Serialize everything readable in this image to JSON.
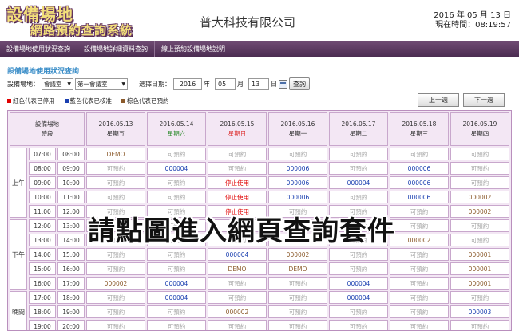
{
  "header": {
    "logo_line1": "設備場地",
    "logo_line2": "網路預約查詢系統",
    "company": "普大科技有限公司",
    "date": "2016 年 05 月 13 日",
    "now": "現在時間：08:19:57"
  },
  "nav": [
    "設備場地使用狀況查詢",
    "設備場地詳細資料查詢",
    "線上預約設備場地說明"
  ],
  "section_title": "設備場地使用狀況查詢",
  "filters": {
    "venue_label": "設備場地：",
    "venue_type": "會議室",
    "venue_name": "第一會議室",
    "date_label": "選擇日期：",
    "year": "2016",
    "year_unit": "年",
    "month": "05",
    "month_unit": "月",
    "day": "13",
    "day_unit": "日",
    "query_button": "查詢"
  },
  "legend": [
    {
      "text": "紅色代表已停用",
      "color": "#e00000"
    },
    {
      "text": "藍色代表已核准",
      "color": "#1a3fb0"
    },
    {
      "text": "棕色代表已預約",
      "color": "#8b5a2b"
    }
  ],
  "prev_week": "上一週",
  "next_week": "下一週",
  "table": {
    "head_venue": "設備場地",
    "head_slot": "時段",
    "days": [
      {
        "date": "2016.05.13",
        "weekday": "星期五",
        "kind": ""
      },
      {
        "date": "2016.05.14",
        "weekday": "星期六",
        "kind": "sat"
      },
      {
        "date": "2016.05.15",
        "weekday": "星期日",
        "kind": "sun"
      },
      {
        "date": "2016.05.16",
        "weekday": "星期一",
        "kind": ""
      },
      {
        "date": "2016.05.17",
        "weekday": "星期二",
        "kind": ""
      },
      {
        "date": "2016.05.18",
        "weekday": "星期三",
        "kind": ""
      },
      {
        "date": "2016.05.19",
        "weekday": "星期四",
        "kind": ""
      }
    ],
    "periods": [
      {
        "name": "上午",
        "rows": 5
      },
      {
        "name": "下午",
        "rows": 5
      },
      {
        "name": "晚間",
        "rows": 3
      }
    ],
    "rows": [
      {
        "start": "07:00",
        "end": "08:00",
        "cells": [
          [
            "DEMO",
            "brown"
          ],
          [
            "可預約",
            ""
          ],
          [
            "可預約",
            ""
          ],
          [
            "可預約",
            ""
          ],
          [
            "可預約",
            ""
          ],
          [
            "可預約",
            ""
          ],
          [
            "可預約",
            ""
          ]
        ]
      },
      {
        "start": "08:00",
        "end": "09:00",
        "cells": [
          [
            "可預約",
            ""
          ],
          [
            "000004",
            "blue"
          ],
          [
            "可預約",
            ""
          ],
          [
            "000006",
            "blue"
          ],
          [
            "可預約",
            ""
          ],
          [
            "000006",
            "blue"
          ],
          [
            "可預約",
            ""
          ]
        ]
      },
      {
        "start": "09:00",
        "end": "10:00",
        "cells": [
          [
            "可預約",
            ""
          ],
          [
            "可預約",
            ""
          ],
          [
            "停止使用",
            "red"
          ],
          [
            "000006",
            "blue"
          ],
          [
            "000004",
            "blue"
          ],
          [
            "000006",
            "blue"
          ],
          [
            "可預約",
            ""
          ]
        ]
      },
      {
        "start": "10:00",
        "end": "11:00",
        "cells": [
          [
            "可預約",
            ""
          ],
          [
            "可預約",
            ""
          ],
          [
            "停止使用",
            "red"
          ],
          [
            "000006",
            "blue"
          ],
          [
            "可預約",
            ""
          ],
          [
            "000006",
            "blue"
          ],
          [
            "000002",
            "brown"
          ]
        ]
      },
      {
        "start": "11:00",
        "end": "12:00",
        "cells": [
          [
            "可預約",
            ""
          ],
          [
            "可預約",
            ""
          ],
          [
            "停止使用",
            "red"
          ],
          [
            "可預約",
            ""
          ],
          [
            "可預約",
            ""
          ],
          [
            "可預約",
            ""
          ],
          [
            "000002",
            "brown"
          ]
        ]
      },
      {
        "start": "12:00",
        "end": "13:00",
        "cells": [
          [
            "可預約",
            ""
          ],
          [
            "可預約",
            ""
          ],
          [
            "可預約",
            ""
          ],
          [
            "可預約",
            ""
          ],
          [
            "可預約",
            ""
          ],
          [
            "可預約",
            ""
          ],
          [
            "可預約",
            ""
          ]
        ]
      },
      {
        "start": "13:00",
        "end": "14:00",
        "cells": [
          [
            "可預約",
            ""
          ],
          [
            "可預約",
            ""
          ],
          [
            "可預約",
            ""
          ],
          [
            "可預約",
            ""
          ],
          [
            "可預約",
            ""
          ],
          [
            "000002",
            "brown"
          ],
          [
            "可預約",
            ""
          ]
        ]
      },
      {
        "start": "14:00",
        "end": "15:00",
        "cells": [
          [
            "可預約",
            ""
          ],
          [
            "可預約",
            ""
          ],
          [
            "000004",
            "blue"
          ],
          [
            "000002",
            "brown"
          ],
          [
            "可預約",
            ""
          ],
          [
            "可預約",
            ""
          ],
          [
            "000001",
            "brown"
          ]
        ]
      },
      {
        "start": "15:00",
        "end": "16:00",
        "cells": [
          [
            "可預約",
            ""
          ],
          [
            "可預約",
            ""
          ],
          [
            "DEMO",
            "brown"
          ],
          [
            "DEMO",
            "brown"
          ],
          [
            "可預約",
            ""
          ],
          [
            "可預約",
            ""
          ],
          [
            "000001",
            "brown"
          ]
        ]
      },
      {
        "start": "16:00",
        "end": "17:00",
        "cells": [
          [
            "000002",
            "brown"
          ],
          [
            "000004",
            "blue"
          ],
          [
            "可預約",
            ""
          ],
          [
            "可預約",
            ""
          ],
          [
            "000004",
            "blue"
          ],
          [
            "可預約",
            ""
          ],
          [
            "000001",
            "brown"
          ]
        ]
      },
      {
        "start": "17:00",
        "end": "18:00",
        "cells": [
          [
            "可預約",
            ""
          ],
          [
            "000004",
            "blue"
          ],
          [
            "可預約",
            ""
          ],
          [
            "可預約",
            ""
          ],
          [
            "000004",
            "blue"
          ],
          [
            "可預約",
            ""
          ],
          [
            "可預約",
            ""
          ]
        ]
      },
      {
        "start": "18:00",
        "end": "19:00",
        "cells": [
          [
            "可預約",
            ""
          ],
          [
            "可預約",
            ""
          ],
          [
            "000002",
            "brown"
          ],
          [
            "可預約",
            ""
          ],
          [
            "可預約",
            ""
          ],
          [
            "可預約",
            ""
          ],
          [
            "000003",
            "blue"
          ]
        ]
      },
      {
        "start": "19:00",
        "end": "20:00",
        "cells": [
          [
            "可預約",
            ""
          ],
          [
            "可預約",
            ""
          ],
          [
            "可預約",
            ""
          ],
          [
            "可預約",
            ""
          ],
          [
            "可預約",
            ""
          ],
          [
            "可預約",
            ""
          ],
          [
            "可預約",
            ""
          ]
        ]
      }
    ]
  },
  "banner": "請點圖進入網頁查詢套件"
}
